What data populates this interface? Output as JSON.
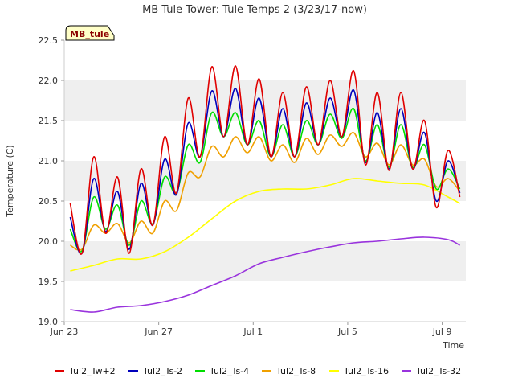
{
  "chart_data": {
    "type": "line",
    "title": "MB Tule Tower: Tule Temps 2 (3/23/17-now)",
    "xlabel": "Time",
    "ylabel": "Temperature (C)",
    "badge": "MB_tule",
    "x_axis": {
      "unit": "date",
      "range": [
        "2017-06-23",
        "2017-07-10"
      ],
      "ticks": [
        {
          "date": "2017-06-23",
          "label": "Jun 23"
        },
        {
          "date": "2017-06-27",
          "label": "Jun 27"
        },
        {
          "date": "2017-07-01",
          "label": "Jul 1"
        },
        {
          "date": "2017-07-05",
          "label": "Jul 5"
        },
        {
          "date": "2017-07-09",
          "label": "Jul 9"
        }
      ]
    },
    "ylim": [
      19.0,
      22.5
    ],
    "yticks": [
      "19.0",
      "19.5",
      "20.0",
      "20.5",
      "21.0",
      "21.5",
      "22.0",
      "22.5"
    ],
    "grid": "horizontal bands",
    "legend_position": "bottom",
    "series": [
      {
        "name": "Tul2_Tw+2",
        "color": "#e00000",
        "x": [
          "2017-06-23T06:00",
          "2017-06-23T18:00",
          "2017-06-24T06:00",
          "2017-06-24T18:00",
          "2017-06-25T06:00",
          "2017-06-25T18:00",
          "2017-06-26T06:00",
          "2017-06-26T18:00",
          "2017-06-27T06:00",
          "2017-06-27T18:00",
          "2017-06-28T06:00",
          "2017-06-28T18:00",
          "2017-06-29T06:00",
          "2017-06-29T18:00",
          "2017-06-30T06:00",
          "2017-06-30T18:00",
          "2017-07-01T06:00",
          "2017-07-01T18:00",
          "2017-07-02T06:00",
          "2017-07-02T18:00",
          "2017-07-03T06:00",
          "2017-07-03T18:00",
          "2017-07-04T06:00",
          "2017-07-04T18:00",
          "2017-07-05T06:00",
          "2017-07-05T18:00",
          "2017-07-06T06:00",
          "2017-07-06T18:00",
          "2017-07-07T06:00",
          "2017-07-07T18:00",
          "2017-07-08T06:00",
          "2017-07-08T18:00",
          "2017-07-09T06:00",
          "2017-07-09T18:00"
        ],
        "values": [
          20.47,
          19.85,
          21.05,
          20.1,
          20.8,
          19.85,
          20.9,
          20.2,
          21.3,
          20.6,
          21.78,
          21.05,
          22.17,
          21.3,
          22.18,
          21.2,
          22.02,
          21.05,
          21.85,
          21.05,
          21.92,
          21.2,
          22.0,
          21.3,
          22.12,
          20.95,
          21.85,
          20.88,
          21.85,
          20.9,
          21.5,
          20.42,
          21.13,
          20.55
        ]
      },
      {
        "name": "Tul2_Ts-2",
        "color": "#0000bb",
        "x": [
          "2017-06-23T06:00",
          "2017-06-23T18:00",
          "2017-06-24T06:00",
          "2017-06-24T18:00",
          "2017-06-25T06:00",
          "2017-06-25T18:00",
          "2017-06-26T06:00",
          "2017-06-26T18:00",
          "2017-06-27T06:00",
          "2017-06-27T18:00",
          "2017-06-28T06:00",
          "2017-06-28T18:00",
          "2017-06-29T06:00",
          "2017-06-29T18:00",
          "2017-06-30T06:00",
          "2017-06-30T18:00",
          "2017-07-01T06:00",
          "2017-07-01T18:00",
          "2017-07-02T06:00",
          "2017-07-02T18:00",
          "2017-07-03T06:00",
          "2017-07-03T18:00",
          "2017-07-04T06:00",
          "2017-07-04T18:00",
          "2017-07-05T06:00",
          "2017-07-05T18:00",
          "2017-07-06T06:00",
          "2017-07-06T18:00",
          "2017-07-07T06:00",
          "2017-07-07T18:00",
          "2017-07-08T06:00",
          "2017-07-08T18:00",
          "2017-07-09T06:00",
          "2017-07-09T18:00"
        ],
        "values": [
          20.3,
          19.85,
          20.78,
          20.12,
          20.62,
          19.9,
          20.72,
          20.2,
          21.02,
          20.58,
          21.47,
          21.05,
          21.87,
          21.3,
          21.9,
          21.2,
          21.78,
          21.05,
          21.65,
          21.05,
          21.72,
          21.2,
          21.78,
          21.3,
          21.88,
          20.98,
          21.6,
          20.9,
          21.65,
          20.9,
          21.35,
          20.5,
          21.0,
          20.6
        ]
      },
      {
        "name": "Tul2_Ts-4",
        "color": "#00dd00",
        "x": [
          "2017-06-23T06:00",
          "2017-06-23T18:00",
          "2017-06-24T06:00",
          "2017-06-24T18:00",
          "2017-06-25T06:00",
          "2017-06-25T18:00",
          "2017-06-26T06:00",
          "2017-06-26T18:00",
          "2017-06-27T06:00",
          "2017-06-27T18:00",
          "2017-06-28T06:00",
          "2017-06-28T18:00",
          "2017-06-29T06:00",
          "2017-06-29T18:00",
          "2017-06-30T06:00",
          "2017-06-30T18:00",
          "2017-07-01T06:00",
          "2017-07-01T18:00",
          "2017-07-02T06:00",
          "2017-07-02T18:00",
          "2017-07-03T06:00",
          "2017-07-03T18:00",
          "2017-07-04T06:00",
          "2017-07-04T18:00",
          "2017-07-05T06:00",
          "2017-07-05T18:00",
          "2017-07-06T06:00",
          "2017-07-06T18:00",
          "2017-07-07T06:00",
          "2017-07-07T18:00",
          "2017-07-08T06:00",
          "2017-07-08T18:00",
          "2017-07-09T06:00",
          "2017-07-09T18:00"
        ],
        "values": [
          20.15,
          19.88,
          20.55,
          20.15,
          20.45,
          19.95,
          20.5,
          20.22,
          20.8,
          20.6,
          21.2,
          20.98,
          21.6,
          21.3,
          21.6,
          21.2,
          21.5,
          21.05,
          21.45,
          21.05,
          21.5,
          21.2,
          21.58,
          21.28,
          21.65,
          21.0,
          21.45,
          20.92,
          21.45,
          20.92,
          21.2,
          20.65,
          20.9,
          20.65
        ]
      },
      {
        "name": "Tul2_Ts-8",
        "color": "#f0a000",
        "x": [
          "2017-06-23T06:00",
          "2017-06-23T18:00",
          "2017-06-24T06:00",
          "2017-06-24T18:00",
          "2017-06-25T06:00",
          "2017-06-25T18:00",
          "2017-06-26T06:00",
          "2017-06-26T18:00",
          "2017-06-27T06:00",
          "2017-06-27T18:00",
          "2017-06-28T06:00",
          "2017-06-28T18:00",
          "2017-06-29T06:00",
          "2017-06-29T18:00",
          "2017-06-30T06:00",
          "2017-06-30T18:00",
          "2017-07-01T06:00",
          "2017-07-01T18:00",
          "2017-07-02T06:00",
          "2017-07-02T18:00",
          "2017-07-03T06:00",
          "2017-07-03T18:00",
          "2017-07-04T06:00",
          "2017-07-04T18:00",
          "2017-07-05T06:00",
          "2017-07-05T18:00",
          "2017-07-06T06:00",
          "2017-07-06T18:00",
          "2017-07-07T06:00",
          "2017-07-07T18:00",
          "2017-07-08T06:00",
          "2017-07-08T18:00",
          "2017-07-09T06:00",
          "2017-07-09T18:00"
        ],
        "values": [
          19.95,
          19.9,
          20.2,
          20.1,
          20.22,
          19.98,
          20.25,
          20.1,
          20.5,
          20.38,
          20.85,
          20.8,
          21.18,
          21.05,
          21.3,
          21.1,
          21.3,
          21.0,
          21.2,
          20.98,
          21.28,
          21.08,
          21.32,
          21.18,
          21.35,
          21.05,
          21.22,
          20.95,
          21.2,
          20.95,
          21.02,
          20.68,
          20.78,
          20.62
        ]
      },
      {
        "name": "Tul2_Ts-16",
        "color": "#ffff00",
        "x": [
          "2017-06-23T06:00",
          "2017-06-24T06:00",
          "2017-06-25T06:00",
          "2017-06-26T06:00",
          "2017-06-27T06:00",
          "2017-06-28T06:00",
          "2017-06-29T06:00",
          "2017-06-30T06:00",
          "2017-07-01T06:00",
          "2017-07-02T06:00",
          "2017-07-03T06:00",
          "2017-07-04T06:00",
          "2017-07-05T06:00",
          "2017-07-06T06:00",
          "2017-07-07T06:00",
          "2017-07-08T06:00",
          "2017-07-09T06:00",
          "2017-07-09T18:00"
        ],
        "values": [
          19.63,
          19.7,
          19.78,
          19.78,
          19.87,
          20.05,
          20.28,
          20.5,
          20.62,
          20.65,
          20.65,
          20.7,
          20.78,
          20.75,
          20.72,
          20.7,
          20.55,
          20.47
        ]
      },
      {
        "name": "Tul2_Ts-32",
        "color": "#9933dd",
        "x": [
          "2017-06-23T06:00",
          "2017-06-24T06:00",
          "2017-06-25T06:00",
          "2017-06-26T06:00",
          "2017-06-27T06:00",
          "2017-06-28T06:00",
          "2017-06-29T06:00",
          "2017-06-30T06:00",
          "2017-07-01T06:00",
          "2017-07-02T06:00",
          "2017-07-03T06:00",
          "2017-07-04T06:00",
          "2017-07-05T06:00",
          "2017-07-06T06:00",
          "2017-07-07T06:00",
          "2017-07-08T06:00",
          "2017-07-09T06:00",
          "2017-07-09T18:00"
        ],
        "values": [
          19.15,
          19.12,
          19.18,
          19.2,
          19.25,
          19.33,
          19.45,
          19.57,
          19.72,
          19.8,
          19.87,
          19.93,
          19.98,
          20.0,
          20.03,
          20.05,
          20.02,
          19.95
        ]
      }
    ]
  }
}
